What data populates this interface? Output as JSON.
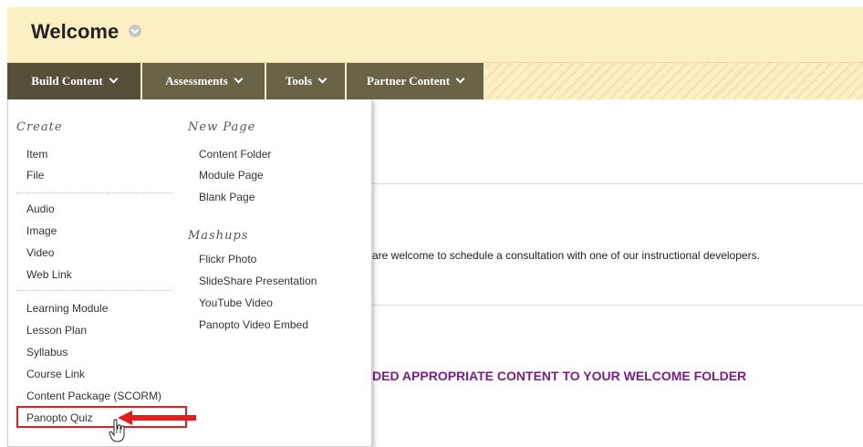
{
  "header": {
    "title": "Welcome",
    "title_icon": "chevron-circle-icon"
  },
  "nav": {
    "tabs": [
      {
        "label": "Build Content"
      },
      {
        "label": "Assessments"
      },
      {
        "label": "Tools"
      },
      {
        "label": "Partner Content"
      }
    ]
  },
  "menu": {
    "create": {
      "title": "Create",
      "items": [
        "Item",
        "File",
        "Audio",
        "Image",
        "Video",
        "Web Link",
        "Learning Module",
        "Lesson Plan",
        "Syllabus",
        "Course Link",
        "Content Package (SCORM)",
        "Panopto Quiz"
      ]
    },
    "new_page": {
      "title": "New Page",
      "items": [
        "Content Folder",
        "Module Page",
        "Blank Page"
      ]
    },
    "mashups": {
      "title": "Mashups",
      "items": [
        "Flickr Photo",
        "SlideShare Presentation",
        "YouTube Video",
        "Panopto Video Embed"
      ]
    }
  },
  "content": {
    "text": "are welcome to schedule a consultation with one of our instructional developers.",
    "heading": "DED APPROPRIATE CONTENT TO YOUR WELCOME FOLDER"
  },
  "colors": {
    "header_bg": "#fdefc4",
    "tab_bg": "#6b6348",
    "highlight": "#e02020",
    "heading": "#7a1f86"
  }
}
